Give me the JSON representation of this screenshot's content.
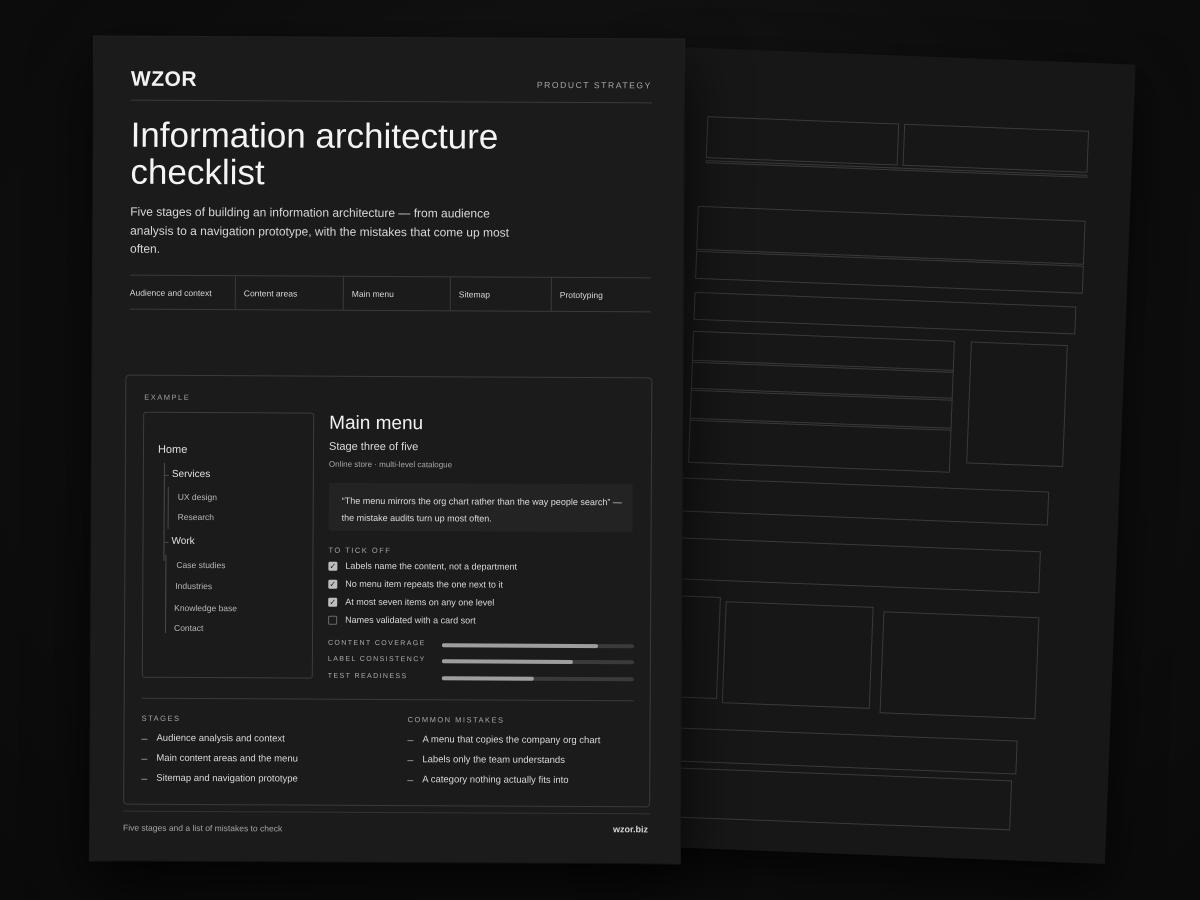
{
  "header": {
    "logo": "WZOR",
    "category": "PRODUCT STRATEGY"
  },
  "title": "Information architecture checklist",
  "intro": "Five stages of building an information architecture — from audience analysis to a navigation prototype, with the mistakes that come up most often.",
  "stage_tabs": [
    "Audience and context",
    "Content areas",
    "Main menu",
    "Sitemap",
    "Prototyping"
  ],
  "example": {
    "label": "EXAMPLE",
    "tree": {
      "root": "Home",
      "groups": [
        {
          "label": "Services",
          "children": [
            "UX design",
            "Research"
          ]
        },
        {
          "label": "Work",
          "children": [
            "Case studies",
            "Industries",
            "Knowledge base",
            "Contact"
          ]
        }
      ]
    },
    "panel": {
      "title": "Main menu",
      "subtitle": "Stage three of five",
      "meta": "Online store · multi-level catalogue",
      "quote": "“The menu mirrors the org chart rather than the way people search” — the mistake audits turn up most often."
    },
    "todo": {
      "label": "TO TICK OFF",
      "items": [
        {
          "text": "Labels name the content, not a department",
          "checked": true
        },
        {
          "text": "No menu item repeats the one next to it",
          "checked": true
        },
        {
          "text": "At most seven items on any one level",
          "checked": true
        },
        {
          "text": "Names validated with a card sort",
          "checked": false
        }
      ]
    },
    "metrics": [
      {
        "label": "CONTENT COVERAGE",
        "value": 0.81
      },
      {
        "label": "LABEL CONSISTENCY",
        "value": 0.68
      },
      {
        "label": "TEST READINESS",
        "value": 0.48
      }
    ],
    "stages": {
      "heading": "STAGES",
      "items": [
        "Audience analysis and context",
        "Main content areas and the menu",
        "Sitemap and navigation prototype"
      ]
    },
    "mistakes": {
      "heading": "COMMON MISTAKES",
      "items": [
        "A menu that copies the company org chart",
        "Labels only the team understands",
        "A category nothing actually fits into"
      ]
    }
  },
  "footer": {
    "left": "Five stages and a list of mistakes to check",
    "right": "wzor.biz"
  },
  "colors": {
    "background": "#0e0e0e",
    "sheet": "#1b1b1b",
    "rule": "#3a3a3a",
    "text": "#e8e8e8",
    "muted": "#a6a6a6",
    "check": "#bdbdbd"
  }
}
